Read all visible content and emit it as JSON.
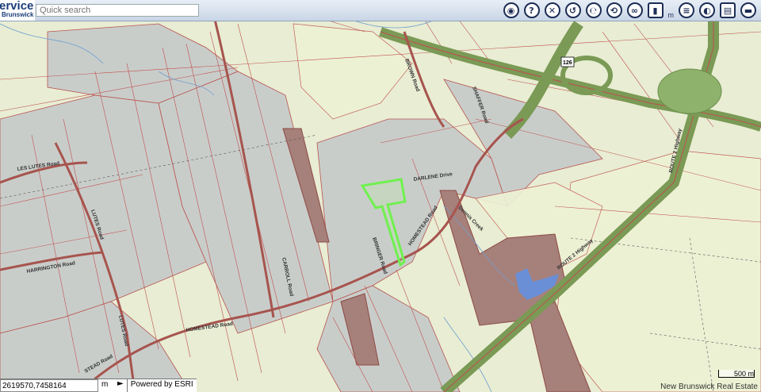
{
  "logo": {
    "line1": "ervice",
    "line2": "Brunswick"
  },
  "search": {
    "placeholder": "Quick search"
  },
  "toolbar": {
    "unit_label": "m",
    "tools": [
      "globe-icon",
      "help-cursor-icon",
      "close-icon",
      "query-icon",
      "ear-icon",
      "rotate-icon",
      "binoculars-icon",
      "ruler-icon",
      "layers-icon",
      "eye-icon",
      "print-icon",
      "vehicle-icon"
    ]
  },
  "coordinates": {
    "value": "2619570,7458164",
    "unit": "m",
    "go": "►"
  },
  "attribution": {
    "powered": "Powered by ESRI",
    "copyright": "New Brunswick Real Estate"
  },
  "scale": {
    "label": "500 m"
  },
  "map_labels": {
    "les_lutes": "LES LUTES Road",
    "harrington": "HARRINGTON Road",
    "lutes": "LUTES Road",
    "homestead_w": "HOMESTEAD Road",
    "homestead_sw": "STEAD Road",
    "homestead_e": "HOMESTEAD Road",
    "carroll": "CARROLL Road",
    "bringer": "BRINGER Road",
    "darlene": "DARLENE Drive",
    "dennis_creek": "Dennis Creek",
    "route2_a": "ROUTE 2 Highway",
    "route2_b": "ROUTE 2 Highway",
    "shaffer": "SHAFFER Road",
    "brown": "BROWN Road",
    "route_badge": "126"
  }
}
